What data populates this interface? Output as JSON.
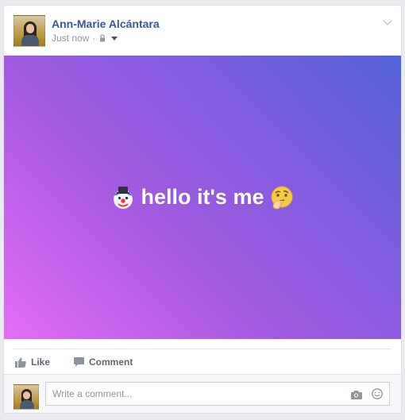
{
  "post": {
    "author_name": "Ann-Marie Alcántara",
    "timestamp": "Just now",
    "separator": "·",
    "privacy_icon": "lock-icon",
    "audience_menu_icon": "caret-down-icon",
    "options_icon": "chevron-down-icon",
    "status": {
      "leading_emoji": "clown-face",
      "text": "hello it's me",
      "trailing_emoji": "thinking-face",
      "background_gradient": [
        "#e46cf6",
        "#a35ae0",
        "#5363d8"
      ]
    }
  },
  "actions": {
    "like_label": "Like",
    "like_icon": "thumbs-up-icon",
    "comment_label": "Comment",
    "comment_icon": "speech-bubble-icon"
  },
  "composer": {
    "placeholder": "Write a comment...",
    "value": "",
    "camera_icon": "camera-icon",
    "emoji_icon": "smiley-icon"
  },
  "colors": {
    "name_link": "#365899",
    "meta_text": "#90949c",
    "action_text": "#606770",
    "page_background": "#e9ebee"
  }
}
